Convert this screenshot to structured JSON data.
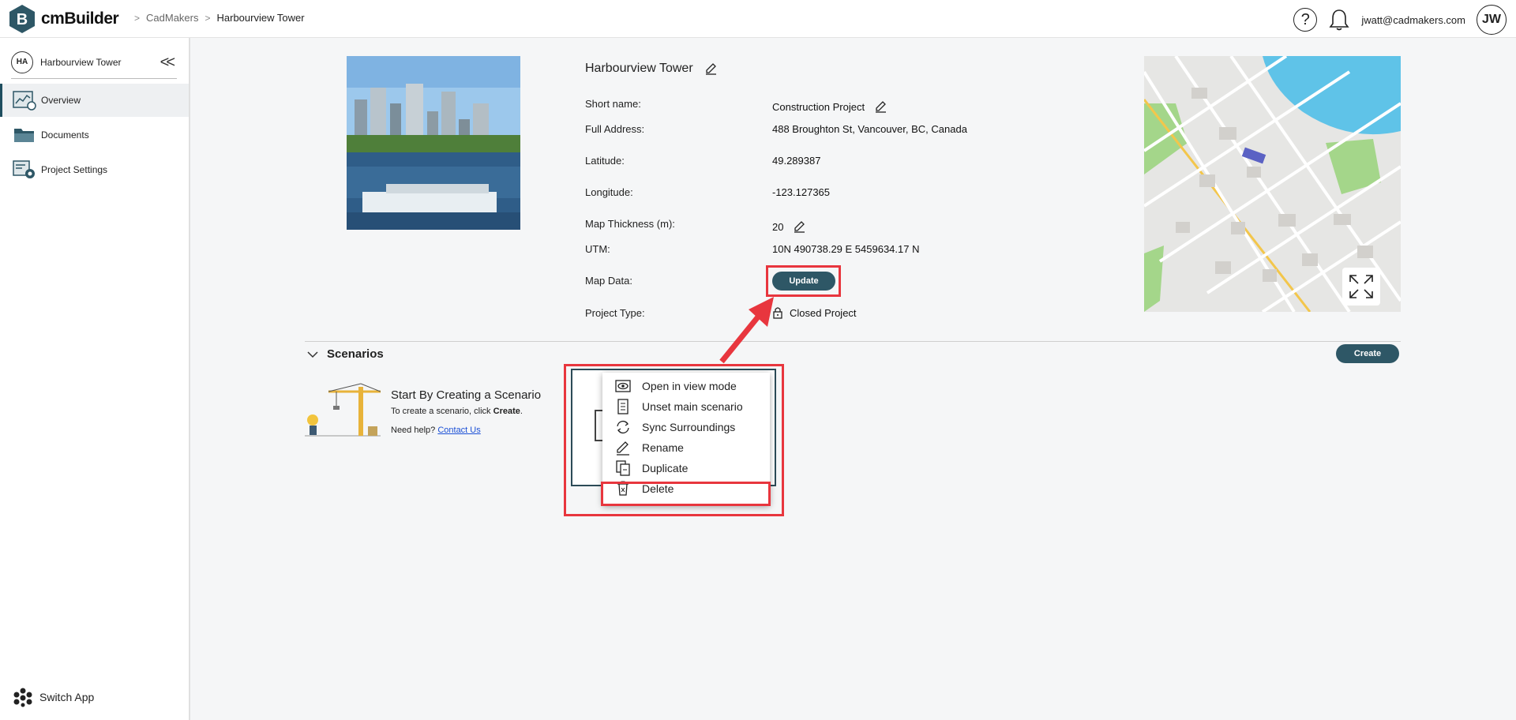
{
  "app": {
    "name": "cmBuilder"
  },
  "breadcrumb": [
    "CadMakers",
    "Harbourview Tower"
  ],
  "user": {
    "email": "jwatt@cadmakers.com",
    "initials": "JW"
  },
  "sidebar": {
    "project_badge": "HA",
    "project_name": "Harbourview Tower",
    "items": [
      {
        "label": "Overview",
        "active": true
      },
      {
        "label": "Documents",
        "active": false
      },
      {
        "label": "Project Settings",
        "active": false
      }
    ],
    "switch_app": "Switch App"
  },
  "project": {
    "title": "Harbourview Tower",
    "fields": {
      "short_name_label": "Short name:",
      "short_name": "Construction Project",
      "address_label": "Full Address:",
      "address": "488 Broughton St, Vancouver, BC, Canada",
      "latitude_label": "Latitude:",
      "latitude": "49.289387",
      "longitude_label": "Longitude:",
      "longitude": "-123.127365",
      "thickness_label": "Map Thickness (m):",
      "thickness": "20",
      "utm_label": "UTM:",
      "utm": "10N 490738.29 E 5459634.17 N",
      "map_data_label": "Map Data:",
      "update_label": "Update",
      "type_label": "Project Type:",
      "type": "Closed Project"
    }
  },
  "scenarios": {
    "heading": "Scenarios",
    "create_label": "Create",
    "empty_title": "Start By Creating a Scenario",
    "empty_sub_prefix": "To create a scenario, click ",
    "empty_sub_bold": "Create",
    "empty_sub_suffix": ".",
    "help_prefix": "Need help? ",
    "help_link": "Contact Us"
  },
  "context_menu": [
    {
      "label": "Open in view mode",
      "icon": "eye-icon"
    },
    {
      "label": "Unset main scenario",
      "icon": "document-icon"
    },
    {
      "label": "Sync Surroundings",
      "icon": "sync-icon"
    },
    {
      "label": "Rename",
      "icon": "pencil-icon"
    },
    {
      "label": "Duplicate",
      "icon": "duplicate-icon"
    },
    {
      "label": "Delete",
      "icon": "trash-icon"
    }
  ],
  "colors": {
    "accent": "#2e5766",
    "highlight": "#e8363e",
    "map_water": "#5fc3e8",
    "map_park": "#a4d68a"
  }
}
